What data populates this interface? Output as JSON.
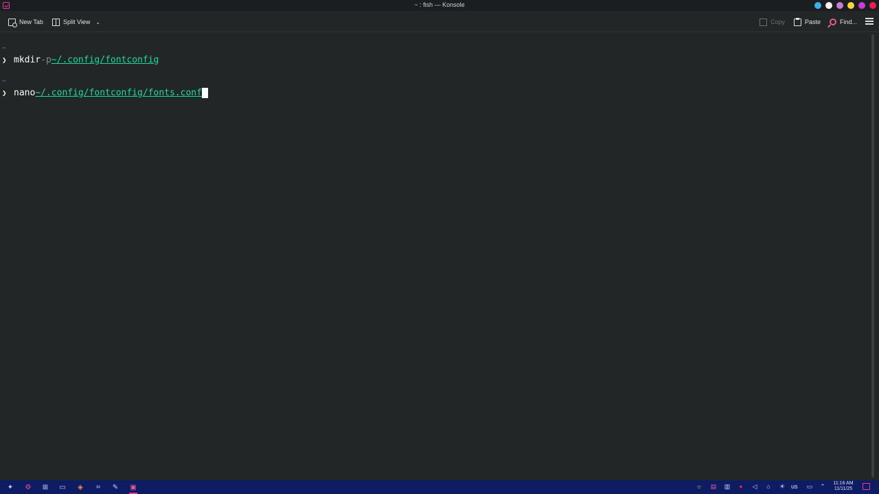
{
  "window": {
    "title": "~ : fish — Konsole",
    "controls": [
      {
        "name": "help",
        "color": "#3daee9"
      },
      {
        "name": "shade",
        "color": "#f6f3ee"
      },
      {
        "name": "keep-above",
        "color": "#c77bd2"
      },
      {
        "name": "minimize",
        "color": "#f7d33d"
      },
      {
        "name": "maximize",
        "color": "#c83dd8"
      },
      {
        "name": "close",
        "color": "#ed1c51"
      }
    ]
  },
  "toolbar": {
    "new_tab": "New Tab",
    "split_view": "Split View",
    "copy": "Copy",
    "paste": "Paste",
    "find": "Find..."
  },
  "terminal": {
    "cwd_marker": "~",
    "prompt_symbol": "❯",
    "lines": [
      {
        "cmd": "mkdir",
        "opt": "-p",
        "path": "~/.config/fontconfig"
      },
      {
        "cmd": "nano",
        "opt": "",
        "path": "~/.config/fontconfig/fonts.conf"
      }
    ]
  },
  "taskbar": {
    "keyboard_layout": "us",
    "time": "11:16 AM",
    "date": "11/11/25"
  },
  "colors": {
    "background": "#232627",
    "path": "#1cdc9a",
    "taskbar": "#0e1c63",
    "accent": "#e93a9a"
  }
}
